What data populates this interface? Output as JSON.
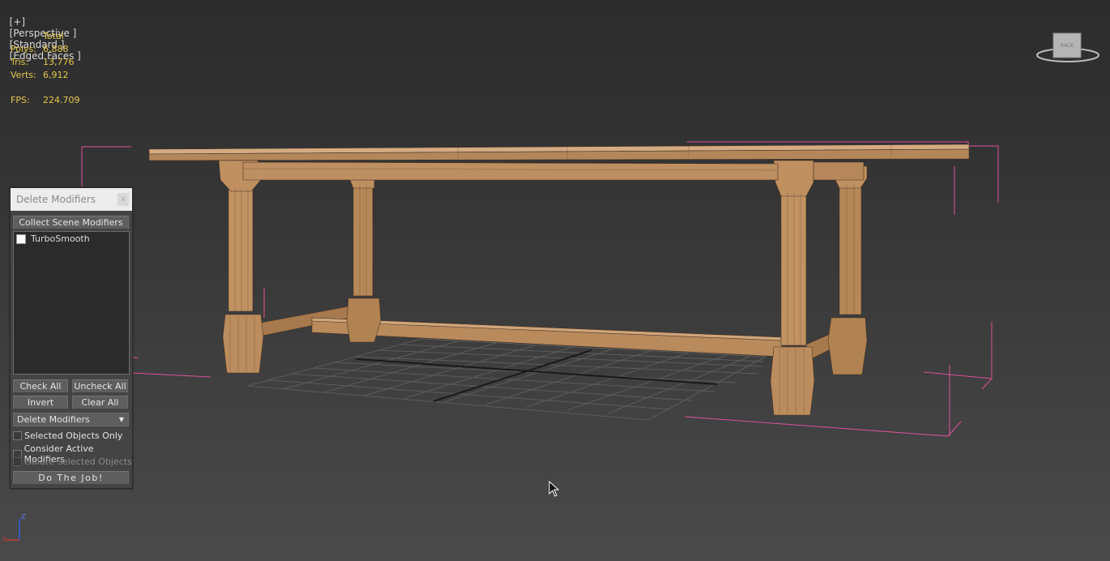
{
  "viewport": {
    "label_plus": "[+]",
    "label_view": "[Perspective ]",
    "label_shading": "[Standard ]",
    "label_edges": "[Edged Faces ]"
  },
  "stats": {
    "header": "Total",
    "polys_label": "Polys:",
    "polys_value": "6,888",
    "tris_label": "Tris:",
    "tris_value": "13,776",
    "verts_label": "Verts:",
    "verts_value": "6,912",
    "fps_label": "FPS:",
    "fps_value": "224.709"
  },
  "viewcube": {
    "face_label": "BACK"
  },
  "gizmo": {
    "z_label": "Z",
    "x_label": "X"
  },
  "dialog": {
    "title": "Delete Modifiers",
    "close_label": "x",
    "collect_button": "Collect Scene Modifiers",
    "list_items": [
      "TurboSmooth"
    ],
    "check_all": "Check All",
    "uncheck_all": "Uncheck All",
    "invert": "Invert",
    "clear_all": "Clear All",
    "mode_select": "Delete Modifiers",
    "opt_selected_only": "Selected Objects Only",
    "opt_consider_active": "Consider Active Modifiers",
    "opt_isolate": "Isolate Selected Objects",
    "do_job": "Do The Job!"
  },
  "colors": {
    "stats_text": "#e6c84a",
    "selection_bracket": "#e0509a",
    "wood": "#b88a5c"
  }
}
